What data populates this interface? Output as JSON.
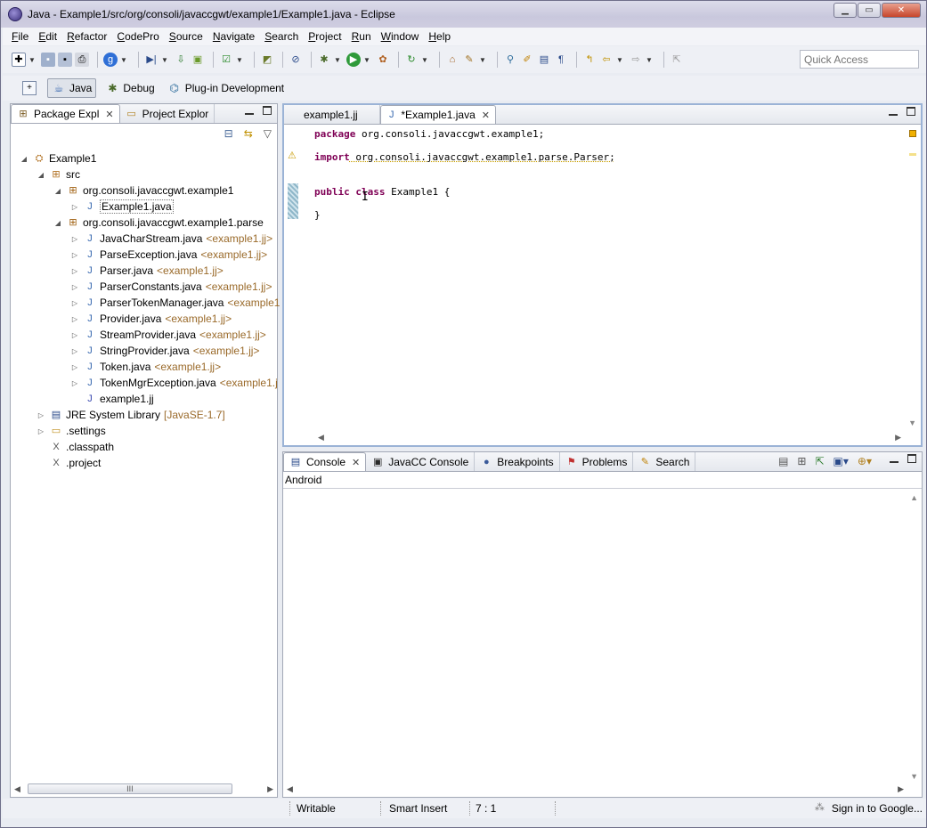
{
  "window": {
    "title": "Java - Example1/src/org/consoli/javaccgwt/example1/Example1.java - Eclipse",
    "minimize_icon": "minimize-icon",
    "maximize_icon": "maximize-icon",
    "close_icon": "close-icon"
  },
  "menu": [
    "File",
    "Edit",
    "Refactor",
    "CodePro",
    "Source",
    "Navigate",
    "Search",
    "Project",
    "Run",
    "Window",
    "Help"
  ],
  "toolbar": {
    "quick_access_placeholder": "Quick Access"
  },
  "perspectives": {
    "items": [
      {
        "label": "Java",
        "active": true,
        "icon": "java-perspective-icon"
      },
      {
        "label": "Debug",
        "active": false,
        "icon": "debug-perspective-icon"
      },
      {
        "label": "Plug-in Development",
        "active": false,
        "icon": "plugin-perspective-icon"
      }
    ]
  },
  "left_panel": {
    "tabs": [
      {
        "label": "Package Expl",
        "active": true,
        "close": "✕"
      },
      {
        "label": "Project Explor",
        "active": false
      }
    ],
    "tree": [
      {
        "label": "Example1",
        "indent": 0,
        "twisty": "◢",
        "icon": "project"
      },
      {
        "label": "src",
        "indent": 1,
        "twisty": "◢",
        "icon": "src"
      },
      {
        "label": "org.consoli.javaccgwt.example1",
        "indent": 2,
        "twisty": "◢",
        "icon": "package"
      },
      {
        "label": "Example1.java",
        "indent": 3,
        "twisty": "▷",
        "icon": "java",
        "selected": true
      },
      {
        "label": "org.consoli.javaccgwt.example1.parse",
        "indent": 2,
        "twisty": "◢",
        "icon": "package"
      },
      {
        "label": "JavaCharStream.java",
        "indent": 3,
        "twisty": "▷",
        "icon": "generated",
        "deco": "<example1.jj>"
      },
      {
        "label": "ParseException.java",
        "indent": 3,
        "twisty": "▷",
        "icon": "generated",
        "deco": "<example1.jj>"
      },
      {
        "label": "Parser.java",
        "indent": 3,
        "twisty": "▷",
        "icon": "generated",
        "deco": "<example1.jj>"
      },
      {
        "label": "ParserConstants.java",
        "indent": 3,
        "twisty": "▷",
        "icon": "generated",
        "deco": "<example1.jj>"
      },
      {
        "label": "ParserTokenManager.java",
        "indent": 3,
        "twisty": "▷",
        "icon": "generated",
        "deco": "<example1"
      },
      {
        "label": "Provider.java",
        "indent": 3,
        "twisty": "▷",
        "icon": "generated",
        "deco": "<example1.jj>"
      },
      {
        "label": "StreamProvider.java",
        "indent": 3,
        "twisty": "▷",
        "icon": "generated",
        "deco": "<example1.jj>"
      },
      {
        "label": "StringProvider.java",
        "indent": 3,
        "twisty": "▷",
        "icon": "generated",
        "deco": "<example1.jj>"
      },
      {
        "label": "Token.java",
        "indent": 3,
        "twisty": "▷",
        "icon": "generated",
        "deco": "<example1.jj>"
      },
      {
        "label": "TokenMgrException.java",
        "indent": 3,
        "twisty": "▷",
        "icon": "generated",
        "deco": "<example1.j"
      },
      {
        "label": "example1.jj",
        "indent": 3,
        "twisty": "",
        "icon": "jj"
      },
      {
        "label": "JRE System Library",
        "indent": 1,
        "twisty": "▷",
        "icon": "library",
        "deco": "[JavaSE-1.7]"
      },
      {
        "label": ".settings",
        "indent": 1,
        "twisty": "▷",
        "icon": "folder"
      },
      {
        "label": ".classpath",
        "indent": 1,
        "twisty": "",
        "icon": "xml"
      },
      {
        "label": ".project",
        "indent": 1,
        "twisty": "",
        "icon": "xml"
      }
    ],
    "hscroll_grip": "III"
  },
  "editor": {
    "tabs": [
      {
        "label": "example1.jj",
        "active": false
      },
      {
        "label": "*Example1.java",
        "active": true,
        "close": "✕"
      }
    ],
    "code": [
      {
        "kw": "package",
        "rest": " org.consoli.javaccgwt.example1;"
      },
      {
        "kw": "import",
        "rest": " org.consoli.javaccgwt.example1.parse.Parser;"
      },
      {
        "kw": "public class",
        "rest": " Example1 {"
      },
      {
        "kw": "",
        "rest": "}"
      }
    ]
  },
  "bottom_panel": {
    "tabs": [
      {
        "label": "Console",
        "active": true,
        "close": "✕",
        "icon": "console-icon"
      },
      {
        "label": "JavaCC Console",
        "active": false,
        "icon": "javacc-console-icon"
      },
      {
        "label": "Breakpoints",
        "active": false,
        "icon": "breakpoints-icon"
      },
      {
        "label": "Problems",
        "active": false,
        "icon": "problems-icon"
      },
      {
        "label": "Search",
        "active": false,
        "icon": "search-icon"
      }
    ],
    "console_name": "Android"
  },
  "status": {
    "writable": "Writable",
    "insert_mode": "Smart Insert",
    "position": "7 : 1",
    "signin": "Sign in to Google..."
  }
}
